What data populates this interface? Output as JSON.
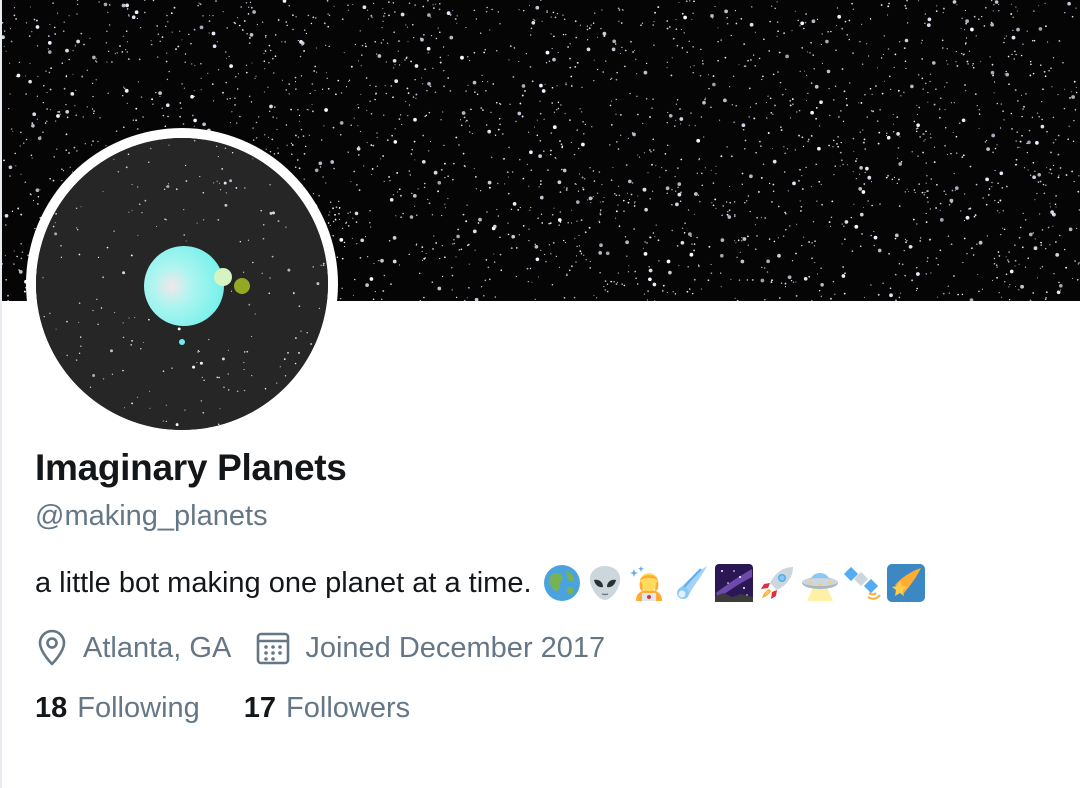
{
  "profile": {
    "display_name": "Imaginary Planets",
    "handle": "@making_planets",
    "bio": "a little bot making one planet at a time.",
    "bio_emojis": [
      "globe-emoji",
      "alien-emoji",
      "astronaut-emoji",
      "comet-emoji",
      "milky-way-emoji",
      "rocket-emoji",
      "ufo-emoji",
      "satellite-emoji",
      "shooting-star-emoji"
    ],
    "location": "Atlanta, GA",
    "joined": "Joined December 2017"
  },
  "stats": {
    "following_count": "18",
    "following_label": "Following",
    "followers_count": "17",
    "followers_label": "Followers"
  },
  "icons": {
    "location": "location-pin-icon",
    "joined": "calendar-icon"
  },
  "colors": {
    "text_primary": "#14171a",
    "text_secondary": "#657786",
    "banner_bg": "#050505",
    "avatar_bg": "#262626",
    "planet": "#7ef0ec",
    "moon": "#94a824"
  }
}
